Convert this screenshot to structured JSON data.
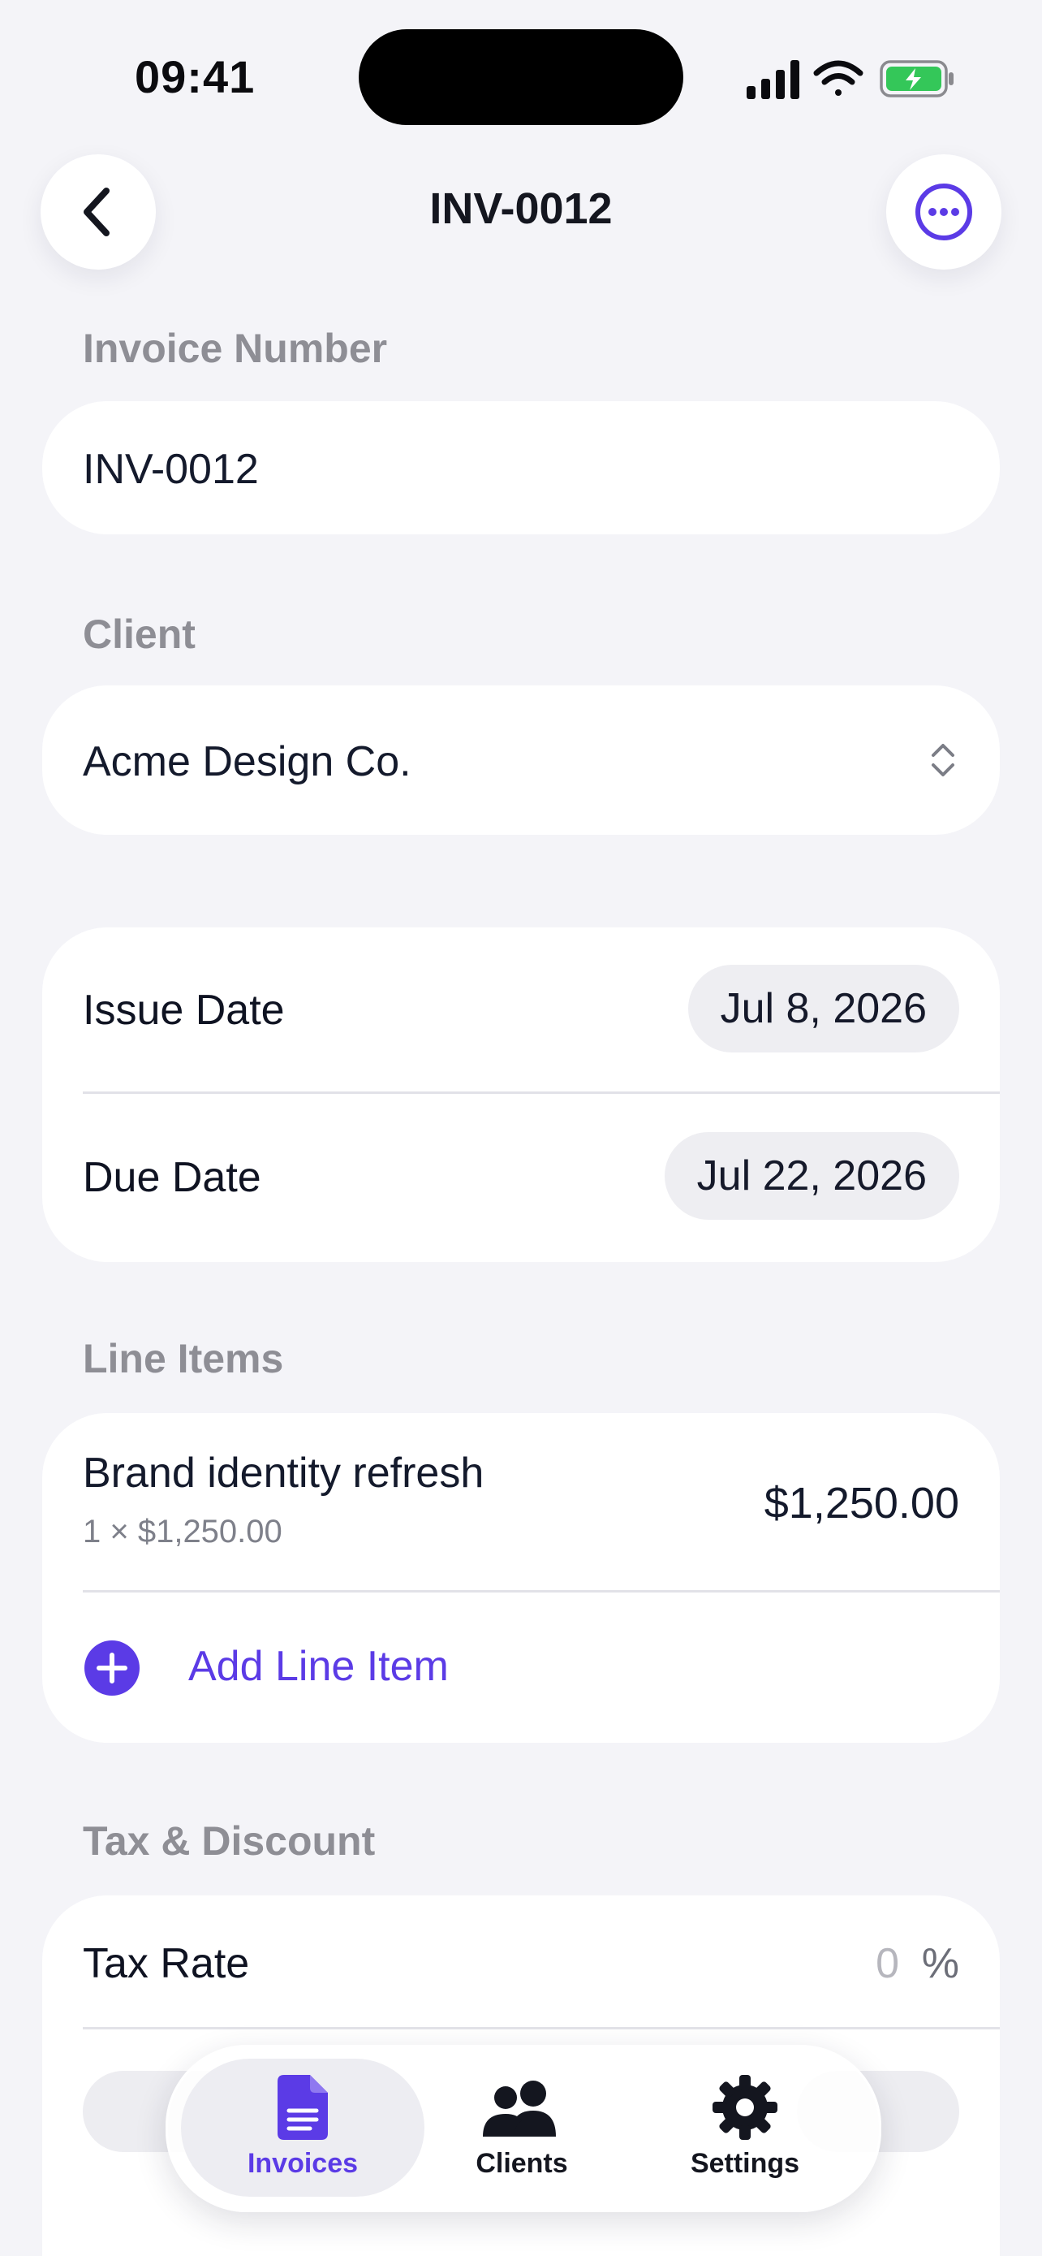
{
  "status_bar": {
    "time": "09:41"
  },
  "nav": {
    "title": "INV-0012"
  },
  "invoice_number": {
    "label": "Invoice Number",
    "value": "INV-0012"
  },
  "client": {
    "label": "Client",
    "value": "Acme Design Co."
  },
  "dates": {
    "issue_label": "Issue Date",
    "issue_value": "Jul 8, 2026",
    "due_label": "Due Date",
    "due_value": "Jul 22, 2026"
  },
  "line_items": {
    "label": "Line Items",
    "items": [
      {
        "title": "Brand identity refresh",
        "detail": "1 × $1,250.00",
        "amount": "$1,250.00"
      }
    ],
    "add_label": "Add Line Item"
  },
  "tax_discount": {
    "label": "Tax & Discount",
    "tax_rate_label": "Tax Rate",
    "tax_rate_value": "0",
    "tax_rate_unit": "%"
  },
  "tab_bar": {
    "tabs": [
      {
        "label": "Invoices",
        "icon": "document-icon",
        "active": true
      },
      {
        "label": "Clients",
        "icon": "people-icon",
        "active": false
      },
      {
        "label": "Settings",
        "icon": "gear-icon",
        "active": false
      }
    ]
  },
  "colors": {
    "accent": "#5b3be6",
    "background": "#f4f4f8",
    "card": "#ffffff"
  }
}
